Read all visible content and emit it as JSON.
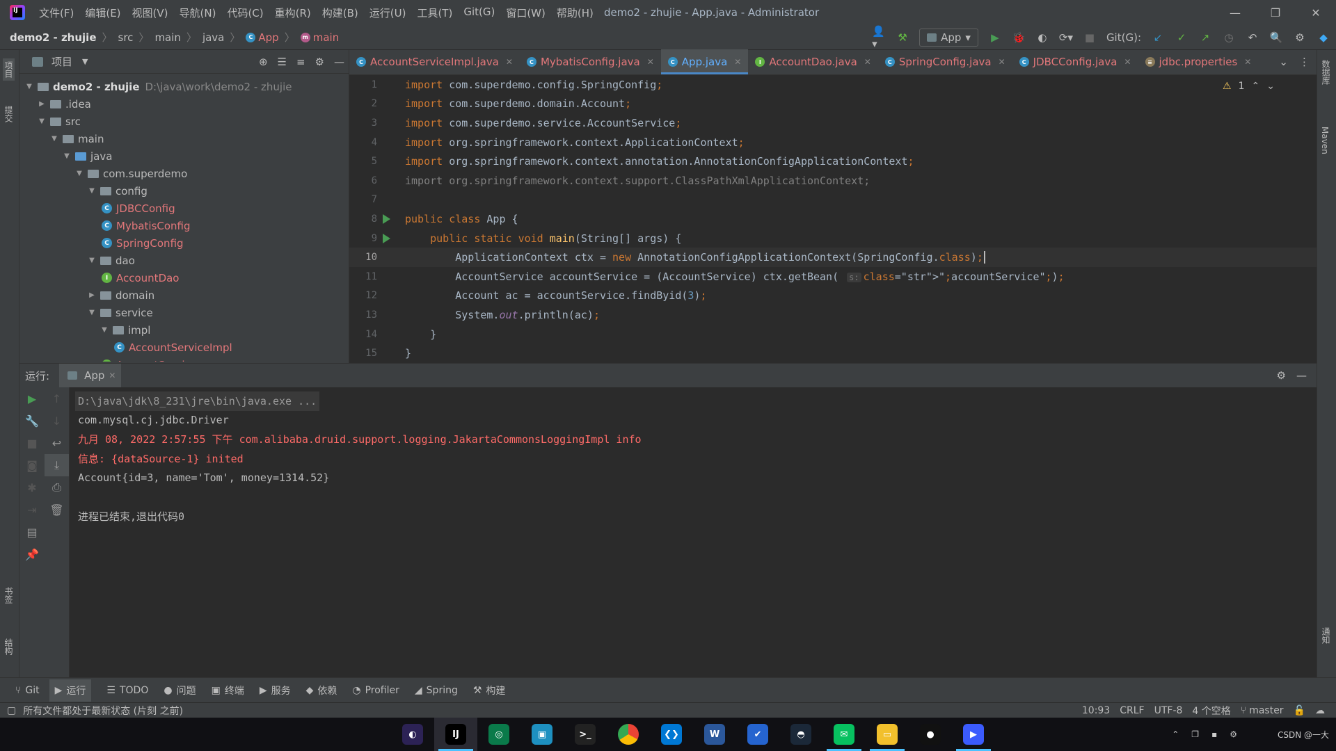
{
  "window": {
    "title": "demo2 - zhujie - App.java - Administrator",
    "menu": [
      "文件(F)",
      "编辑(E)",
      "视图(V)",
      "导航(N)",
      "代码(C)",
      "重构(R)",
      "构建(B)",
      "运行(U)",
      "工具(T)",
      "Git(G)",
      "窗口(W)",
      "帮助(H)"
    ],
    "controls": [
      "—",
      "❐",
      "✕"
    ]
  },
  "breadcrumb": [
    "demo2 - zhujie",
    "src",
    "main",
    "java",
    "App",
    "main"
  ],
  "toolbar": {
    "run_config": "App",
    "git_label": "Git(G):"
  },
  "project": {
    "title": "项目",
    "root_name": "demo2 - zhujie",
    "root_path": "D:\\java\\work\\demo2 - zhujie",
    "tree": [
      {
        "label": "demo2 - zhujie",
        "depth": 0,
        "kind": "root",
        "open": true
      },
      {
        "label": ".idea",
        "depth": 1,
        "kind": "folder",
        "open": false
      },
      {
        "label": "src",
        "depth": 1,
        "kind": "folder",
        "open": true
      },
      {
        "label": "main",
        "depth": 2,
        "kind": "folder",
        "open": true
      },
      {
        "label": "java",
        "depth": 3,
        "kind": "folder-blue",
        "open": true
      },
      {
        "label": "com.superdemo",
        "depth": 4,
        "kind": "folder",
        "open": true
      },
      {
        "label": "config",
        "depth": 5,
        "kind": "folder",
        "open": true
      },
      {
        "label": "JDBCConfig",
        "depth": 6,
        "kind": "class"
      },
      {
        "label": "MybatisConfig",
        "depth": 6,
        "kind": "class"
      },
      {
        "label": "SpringConfig",
        "depth": 6,
        "kind": "class"
      },
      {
        "label": "dao",
        "depth": 5,
        "kind": "folder",
        "open": true
      },
      {
        "label": "AccountDao",
        "depth": 6,
        "kind": "interface"
      },
      {
        "label": "domain",
        "depth": 5,
        "kind": "folder",
        "open": false
      },
      {
        "label": "service",
        "depth": 5,
        "kind": "folder",
        "open": true
      },
      {
        "label": "impl",
        "depth": 6,
        "kind": "folder",
        "open": true
      },
      {
        "label": "AccountServiceImpl",
        "depth": 7,
        "kind": "class"
      },
      {
        "label": "AccountService",
        "depth": 6,
        "kind": "interface"
      }
    ]
  },
  "editor_tabs": [
    {
      "label": "AccountServiceImpl.java",
      "icon": "C",
      "active": false
    },
    {
      "label": "MybatisConfig.java",
      "icon": "C",
      "active": false
    },
    {
      "label": "App.java",
      "icon": "C",
      "active": true
    },
    {
      "label": "AccountDao.java",
      "icon": "I",
      "active": false
    },
    {
      "label": "SpringConfig.java",
      "icon": "C",
      "active": false
    },
    {
      "label": "JDBCConfig.java",
      "icon": "C",
      "active": false
    },
    {
      "label": "jdbc.properties",
      "icon": "P",
      "active": false
    }
  ],
  "warnings": "1",
  "code_lines": [
    "import com.superdemo.config.SpringConfig;",
    "import com.superdemo.domain.Account;",
    "import com.superdemo.service.AccountService;",
    "import org.springframework.context.ApplicationContext;",
    "import org.springframework.context.annotation.AnnotationConfigApplicationContext;",
    "import org.springframework.context.support.ClassPathXmlApplicationContext;",
    "",
    "public class App {",
    "    public static void main(String[] args) {",
    "        ApplicationContext ctx = new AnnotationConfigApplicationContext(SpringConfig.class);",
    "        AccountService accountService = (AccountService) ctx.getBean( s: \"accountService\");",
    "        Account ac = accountService.findByid(3);",
    "        System.out.println(ac);",
    "    }",
    "}"
  ],
  "run": {
    "label": "运行:",
    "tab": "App",
    "console": [
      {
        "text": "D:\\java\\jdk\\8_231\\jre\\bin\\java.exe ...",
        "color": "#999999"
      },
      {
        "text": "com.mysql.cj.jdbc.Driver",
        "color": "#bbbbbb"
      },
      {
        "text": "九月 08, 2022 2:57:55 下午 com.alibaba.druid.support.logging.JakartaCommonsLoggingImpl info",
        "color": "#ff6b68"
      },
      {
        "text": "信息: {dataSource-1} inited",
        "color": "#ff6b68"
      },
      {
        "text": "Account{id=3, name='Tom', money=1314.52}",
        "color": "#bbbbbb"
      },
      {
        "text": "",
        "color": "#bbbbbb"
      },
      {
        "text": "进程已结束,退出代码0",
        "color": "#bbbbbb"
      }
    ]
  },
  "bottom_tools": [
    "Git",
    "运行",
    "TODO",
    "问题",
    "终端",
    "服务",
    "依赖",
    "Profiler",
    "Spring",
    "构建"
  ],
  "left_tool_labels": [
    "项目",
    "提交",
    "书签",
    "结构"
  ],
  "right_tool_labels": [
    "数据库",
    "Maven",
    "通知"
  ],
  "status": {
    "message": "所有文件都处于最新状态 (片刻 之前)",
    "position": "10:93",
    "line_sep": "CRLF",
    "encoding": "UTF-8",
    "indent": "4 个空格",
    "branch": "master"
  },
  "taskbar": {
    "apps": [
      "Eclipse",
      "IntelliJ IDEA",
      "Edge Dev",
      "Screen Tool",
      "Terminal",
      "Chrome",
      "VS Code",
      "Word",
      "To Do",
      "Steam",
      "WeChat",
      "Explorer",
      "Game",
      "Video"
    ],
    "watermark": "CSDN @一大"
  },
  "colors": {
    "accent": "#4a88c7",
    "bg": "#2b2b2b",
    "panel": "#3c3f41",
    "error": "#ff6b68",
    "run": "#499c54"
  }
}
